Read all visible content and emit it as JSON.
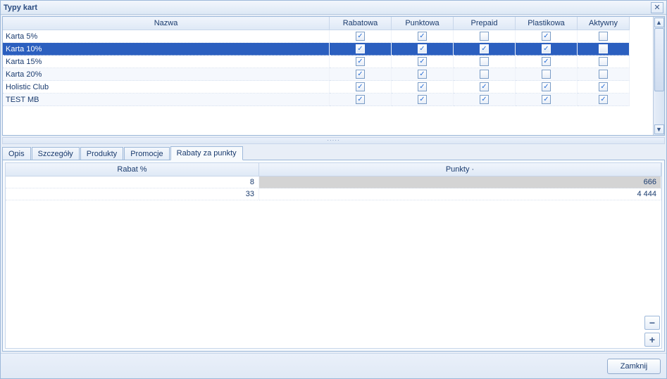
{
  "window": {
    "title": "Typy kart"
  },
  "grid1": {
    "headers": [
      "Nazwa",
      "Rabatowa",
      "Punktowa",
      "Prepaid",
      "Plastikowa",
      "Aktywny"
    ],
    "rows": [
      {
        "name": "Karta 5%",
        "rabatowa": true,
        "punktowa": true,
        "prepaid": false,
        "plastikowa": true,
        "aktywny": false,
        "selected": false
      },
      {
        "name": "Karta 10%",
        "rabatowa": true,
        "punktowa": true,
        "prepaid": true,
        "plastikowa": true,
        "aktywny": false,
        "selected": true
      },
      {
        "name": "Karta 15%",
        "rabatowa": true,
        "punktowa": true,
        "prepaid": false,
        "plastikowa": true,
        "aktywny": false,
        "selected": false
      },
      {
        "name": "Karta 20%",
        "rabatowa": true,
        "punktowa": true,
        "prepaid": false,
        "plastikowa": false,
        "aktywny": false,
        "selected": false
      },
      {
        "name": "Holistic Club",
        "rabatowa": true,
        "punktowa": true,
        "prepaid": true,
        "plastikowa": true,
        "aktywny": true,
        "selected": false
      },
      {
        "name": "TEST MB",
        "rabatowa": true,
        "punktowa": true,
        "prepaid": true,
        "plastikowa": true,
        "aktywny": true,
        "selected": false
      }
    ]
  },
  "tabs": {
    "items": [
      {
        "label": "Opis"
      },
      {
        "label": "Szczegóły"
      },
      {
        "label": "Produkty"
      },
      {
        "label": "Promocje"
      },
      {
        "label": "Rabaty za punkty"
      }
    ],
    "active": 4
  },
  "grid2": {
    "headers": [
      "Rabat %",
      "Punkty ·"
    ],
    "rows": [
      {
        "rabat": "8",
        "punkty": "666",
        "selected": true
      },
      {
        "rabat": "33",
        "punkty": "4 444",
        "selected": false
      }
    ]
  },
  "buttons": {
    "minus": "−",
    "plus": "+",
    "close": "Zamknij",
    "close_x": "✕"
  },
  "splitter_dots": "·····"
}
